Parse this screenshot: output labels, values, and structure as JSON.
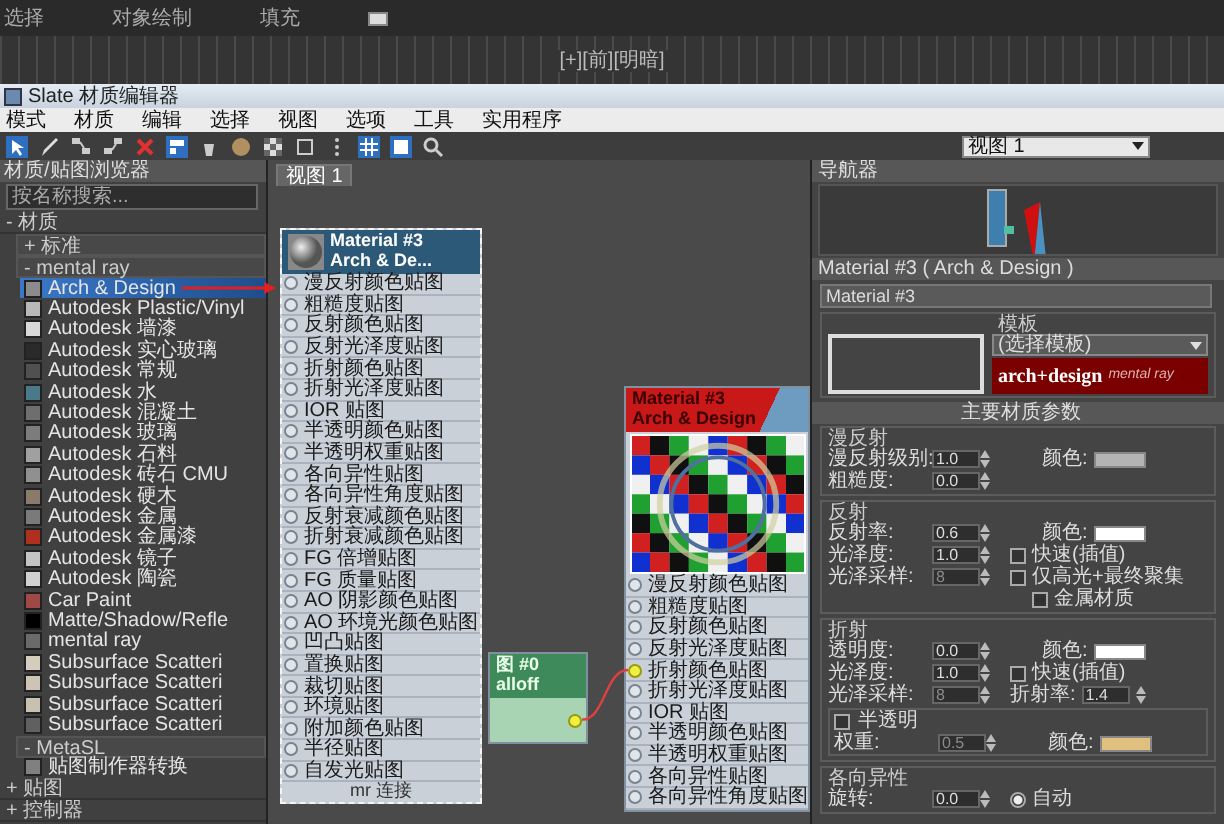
{
  "top_bar": {
    "items": [
      "选择",
      "对象绘制",
      "填充"
    ]
  },
  "viewport_label": "[+][前][明暗]",
  "window": {
    "title": "Slate 材质编辑器"
  },
  "menu": [
    "模式",
    "材质",
    "编辑",
    "选择",
    "视图",
    "选项",
    "工具",
    "实用程序"
  ],
  "view_dropdown": {
    "value": "视图 1"
  },
  "browser": {
    "title": "材质/贴图浏览器",
    "search": {
      "placeholder": "按名称搜索..."
    },
    "groups": [
      {
        "label": "- 材质",
        "children": [
          {
            "label": "+ 标准"
          },
          {
            "label": "- mental ray",
            "items": [
              {
                "label": "Arch & Design",
                "selected": true,
                "color": "#8c8c8c"
              },
              {
                "label": "Autodesk Plastic/Vinyl",
                "selected": false,
                "color": "#b8b8b8"
              },
              {
                "label": "Autodesk 墙漆",
                "selected": false,
                "color": "#d8d8d8"
              },
              {
                "label": "Autodesk 实心玻璃",
                "selected": false,
                "color": "#2a2a2a"
              },
              {
                "label": "Autodesk 常规",
                "selected": false,
                "color": "#505050"
              },
              {
                "label": "Autodesk 水",
                "selected": false,
                "color": "#4a7a8a"
              },
              {
                "label": "Autodesk 混凝土",
                "selected": false,
                "color": "#6e6e6e"
              },
              {
                "label": "Autodesk 玻璃",
                "selected": false,
                "color": "#7c7c7c"
              },
              {
                "label": "Autodesk 石料",
                "selected": false,
                "color": "#a0a0a0"
              },
              {
                "label": "Autodesk 砖石 CMU",
                "selected": false,
                "color": "#909090"
              },
              {
                "label": "Autodesk 硬木",
                "selected": false,
                "color": "#8a7a6a"
              },
              {
                "label": "Autodesk 金属",
                "selected": false,
                "color": "#7a7a7a"
              },
              {
                "label": "Autodesk 金属漆",
                "selected": false,
                "color": "#b03020"
              },
              {
                "label": "Autodesk 镜子",
                "selected": false,
                "color": "#c4c4c4"
              },
              {
                "label": "Autodesk 陶瓷",
                "selected": false,
                "color": "#d0d0d0"
              },
              {
                "label": "Car Paint",
                "selected": false,
                "color": "#a04848"
              },
              {
                "label": "Matte/Shadow/Refle",
                "selected": false,
                "color": "#000000"
              },
              {
                "label": "mental ray",
                "selected": false,
                "color": "#6a6a6a"
              },
              {
                "label": "Subsurface Scatteri",
                "selected": false,
                "color": "#d4ccbc"
              },
              {
                "label": "Subsurface Scatteri",
                "selected": false,
                "color": "#ccc4b4"
              },
              {
                "label": "Subsurface Scatteri",
                "selected": false,
                "color": "#c8c0b0"
              },
              {
                "label": "Subsurface Scatteri",
                "selected": false,
                "color": "#606060"
              }
            ]
          },
          {
            "label": "- MetaSL",
            "items": [
              {
                "label": "贴图制作器转换",
                "selected": false,
                "color": "#808080"
              }
            ]
          }
        ]
      },
      {
        "label": "+ 贴图"
      },
      {
        "label": "+ 控制器"
      }
    ]
  },
  "canvas": {
    "tab": {
      "label": "视图 1",
      "selected": true
    },
    "nodes": [
      {
        "kind": "material",
        "title": "Material #3",
        "subtitle": "Arch & De...",
        "selected": true,
        "active": false,
        "preview": false,
        "footer": "mr 连接",
        "slots": [
          {
            "label": "漫反射颜色贴图",
            "connected": false
          },
          {
            "label": "粗糙度贴图",
            "connected": false
          },
          {
            "label": "反射颜色贴图",
            "connected": false
          },
          {
            "label": "反射光泽度贴图",
            "connected": false
          },
          {
            "label": "折射颜色贴图",
            "connected": false
          },
          {
            "label": "折射光泽度贴图",
            "connected": false
          },
          {
            "label": "IOR 贴图",
            "connected": false
          },
          {
            "label": "半透明颜色贴图",
            "connected": false
          },
          {
            "label": "半透明权重贴图",
            "connected": false
          },
          {
            "label": "各向异性贴图",
            "connected": false
          },
          {
            "label": "各向异性角度贴图",
            "connected": false
          },
          {
            "label": "反射衰减颜色贴图",
            "connected": false
          },
          {
            "label": "折射衰减颜色贴图",
            "connected": false
          },
          {
            "label": "FG 倍增贴图",
            "connected": false
          },
          {
            "label": "FG 质量贴图",
            "connected": false
          },
          {
            "label": "AO 阴影颜色贴图",
            "connected": false
          },
          {
            "label": "AO 环境光颜色贴图",
            "connected": false
          },
          {
            "label": "凹凸贴图",
            "connected": false
          },
          {
            "label": "置换贴图",
            "connected": false
          },
          {
            "label": "裁切贴图",
            "connected": false
          },
          {
            "label": "环境贴图",
            "connected": false
          },
          {
            "label": "附加颜色贴图",
            "connected": false
          },
          {
            "label": "半径贴图",
            "connected": false
          },
          {
            "label": "自发光贴图",
            "connected": false
          }
        ]
      },
      {
        "kind": "map",
        "title": "图 #0",
        "subtitle": "alloff",
        "selected": false,
        "output_connected": true
      },
      {
        "kind": "material",
        "title": "Material #3",
        "subtitle": "Arch & Design",
        "selected": false,
        "active": true,
        "preview": true,
        "slots": [
          {
            "label": "漫反射颜色贴图",
            "connected": false
          },
          {
            "label": "粗糙度贴图",
            "connected": false
          },
          {
            "label": "反射颜色贴图",
            "connected": false
          },
          {
            "label": "反射光泽度贴图",
            "connected": false
          },
          {
            "label": "折射颜色贴图",
            "connected": true
          },
          {
            "label": "折射光泽度贴图",
            "connected": false
          },
          {
            "label": "IOR 贴图",
            "connected": false
          },
          {
            "label": "半透明颜色贴图",
            "connected": false
          },
          {
            "label": "半透明权重贴图",
            "connected": false
          },
          {
            "label": "各向异性贴图",
            "connected": false
          },
          {
            "label": "各向异性角度贴图",
            "connected": false
          }
        ]
      }
    ]
  },
  "navigator": {
    "title": "导航器"
  },
  "parameters": {
    "title": "Material #3  ( Arch & Design )",
    "name": "Material #3",
    "template": {
      "title": "模板",
      "dropdown": "(选择模板)",
      "logo": "arch+design",
      "logo_tag": "mental ray"
    },
    "rollout": "主要材质参数",
    "groups": [
      {
        "title": "漫反射",
        "rows": [
          {
            "label": "漫反射级别:",
            "value": "1.0",
            "disabled": false,
            "side": {
              "kind": "color",
              "label": "颜色:",
              "color": "#b4b4b4"
            }
          },
          {
            "label": "粗糙度:",
            "value": "0.0",
            "disabled": false
          }
        ]
      },
      {
        "title": "反射",
        "rows": [
          {
            "label": "反射率:",
            "value": "0.6",
            "disabled": false,
            "side": {
              "kind": "color",
              "label": "颜色:",
              "color": "#ffffff"
            }
          },
          {
            "label": "光泽度:",
            "value": "1.0",
            "disabled": false,
            "side": {
              "kind": "checkbox",
              "label": "快速(插值)",
              "checked": false
            }
          },
          {
            "label": "光泽采样:",
            "value": "8",
            "disabled": true,
            "side": {
              "kind": "checkbox",
              "label": "仅高光+最终聚集",
              "checked": false
            }
          },
          {
            "side": {
              "kind": "checkbox",
              "label": "金属材质",
              "checked": false
            }
          }
        ]
      },
      {
        "title": "折射",
        "rows": [
          {
            "label": "透明度:",
            "value": "0.0",
            "disabled": false,
            "side": {
              "kind": "color",
              "label": "颜色:",
              "color": "#ffffff"
            }
          },
          {
            "label": "光泽度:",
            "value": "1.0",
            "disabled": false,
            "side": {
              "kind": "checkbox",
              "label": "快速(插值)",
              "checked": false
            }
          },
          {
            "label": "光泽采样:",
            "value": "8",
            "disabled": true,
            "side": {
              "kind": "spinner",
              "label": "折射率:",
              "value": "1.4"
            }
          }
        ],
        "subgroup": {
          "label": "半透明",
          "checked": false,
          "rows": [
            {
              "label": "权重:",
              "value": "0.5",
              "disabled": true,
              "side": {
                "kind": "color",
                "label": "颜色:",
                "color": "#e0c080"
              }
            }
          ]
        }
      },
      {
        "title": "各向异性",
        "rows": [
          {
            "label": "旋转:",
            "value": "0.0",
            "disabled": false,
            "side": {
              "kind": "radio",
              "label": "自动",
              "selected": true
            }
          }
        ]
      }
    ]
  }
}
